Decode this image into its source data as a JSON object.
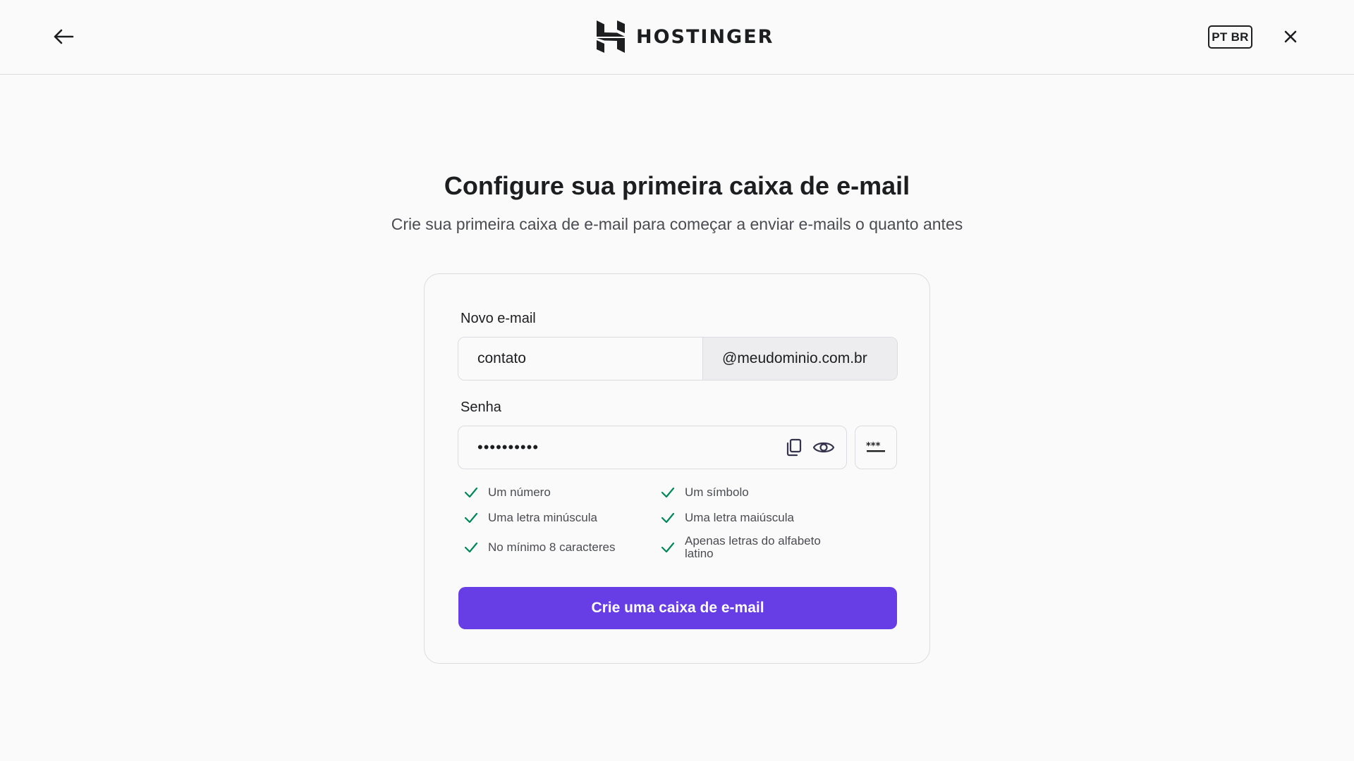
{
  "header": {
    "brand": "HOSTINGER",
    "language": "PT BR"
  },
  "page": {
    "title": "Configure sua primeira caixa de e-mail",
    "subtitle": "Crie sua primeira caixa de e-mail para começar a enviar e-mails o quanto antes"
  },
  "form": {
    "email_label": "Novo e-mail",
    "email_value": "contato",
    "email_domain": "@meudominio.com.br",
    "password_label": "Senha",
    "password_masked": "••••••••••",
    "requirements": [
      "Um número",
      "Um símbolo",
      "Uma letra minúscula",
      "Uma letra maiúscula",
      "No mínimo 8 caracteres",
      "Apenas letras do alfabeto latino"
    ],
    "submit_label": "Crie uma caixa de e-mail"
  },
  "colors": {
    "accent": "#673de6",
    "check": "#00875a"
  }
}
